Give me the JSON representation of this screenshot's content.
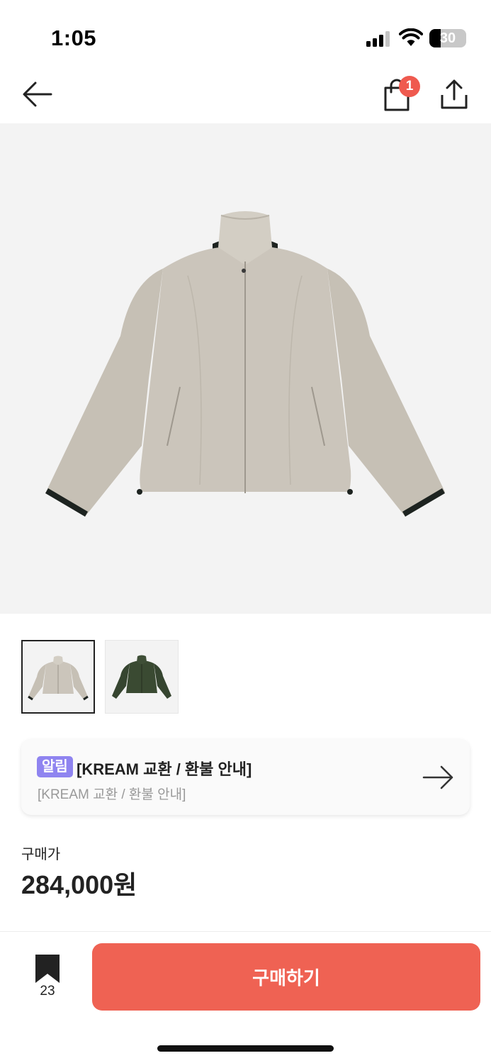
{
  "status_bar": {
    "time": "1:05",
    "battery_level": "30"
  },
  "nav": {
    "back_icon": "arrow-left-icon",
    "cart_icon": "shopping-bag-icon",
    "cart_count": "1",
    "share_icon": "share-icon"
  },
  "product": {
    "image": "beige-stand-collar-jacket",
    "thumbnails": [
      {
        "image": "beige-jacket-thumbnail",
        "selected": true
      },
      {
        "image": "olive-green-jacket-thumbnail",
        "selected": false
      }
    ]
  },
  "notice": {
    "tag": "알림",
    "title": "[KREAM 교환 / 환불 안내]",
    "subtitle": "[KREAM 교환 / 환불 안내]",
    "arrow_icon": "arrow-right-icon"
  },
  "price": {
    "label": "구매가",
    "value": "284,000원"
  },
  "bottom_bar": {
    "bookmark_icon": "bookmark-icon",
    "bookmark_count": "23",
    "buy_label": "구매하기"
  },
  "colors": {
    "accent": "#ef6253",
    "badge": "#ef5a4f",
    "notice_tag": "#8f84f0",
    "image_background": "#f3f3f3"
  }
}
